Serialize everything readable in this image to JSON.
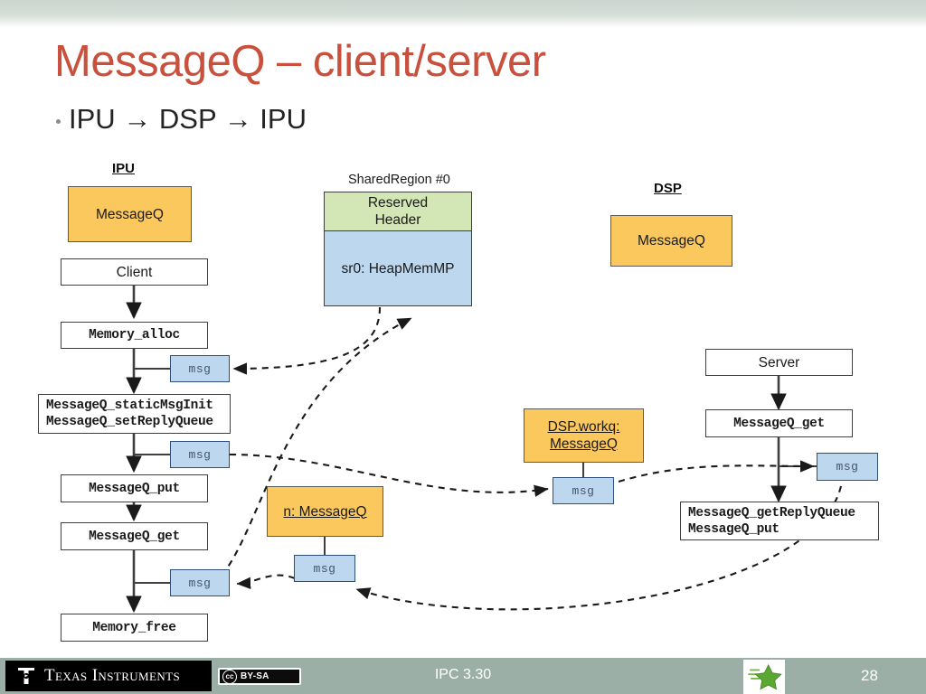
{
  "slide": {
    "title": "MessageQ – client/server",
    "bullet": "IPU → DSP → IPU",
    "title_color": "#c8503c"
  },
  "headings": {
    "ipu": "IPU",
    "dsp": "DSP",
    "shared_region": "SharedRegion #0"
  },
  "ipu_column": {
    "messageq_module": "MessageQ",
    "client": "Client",
    "memory_alloc": "Memory_alloc",
    "static_init_line1": "MessageQ_staticMsgInit",
    "static_init_line2": "MessageQ_setReplyQueue",
    "messageq_put": "MessageQ_put",
    "messageq_get": "MessageQ_get",
    "memory_free": "Memory_free",
    "msg_alloc": "msg",
    "msg_put": "msg",
    "msg_get": "msg"
  },
  "shared_region": {
    "reserved_header_line1": "Reserved",
    "reserved_header_line2": "Header",
    "heap": "sr0: HeapMemMP"
  },
  "dsp_column": {
    "messageq_module": "MessageQ",
    "server": "Server",
    "messageq_get": "MessageQ_get",
    "reply_line1": "MessageQ_getReplyQueue",
    "reply_line2": "MessageQ_put",
    "msg_server": "msg"
  },
  "queues": {
    "dsp_workq_line1": "DSP.workq:",
    "dsp_workq_line2": "MessageQ",
    "dsp_workq_msg": "msg",
    "reply_queue": "n: MessageQ",
    "reply_queue_msg": "msg"
  },
  "colors": {
    "orange": "#fbc85e",
    "blue": "#bdd7ee",
    "green": "#d3e6b5",
    "footer_bar": "#9cafa6",
    "title_red": "#c8503c"
  },
  "footer": {
    "brand": "Texas Instruments",
    "license_cc": "cc",
    "license_text": "BY-SA",
    "center_text": "IPC 3.30",
    "page_number": "28"
  }
}
